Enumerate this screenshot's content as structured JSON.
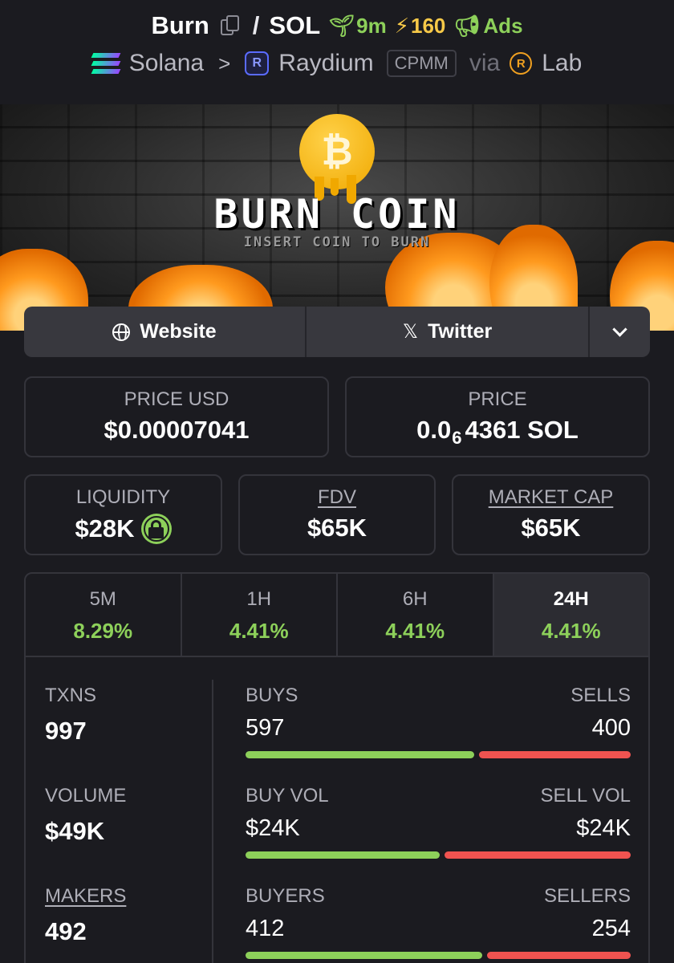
{
  "header": {
    "token_symbol": "Burn",
    "separator": "/",
    "quote_symbol": "SOL",
    "age": "9m",
    "boost": "160",
    "ads_label": "Ads",
    "chain": "Solana",
    "dex": "Raydium",
    "pool_type": "CPMM",
    "via_label": "via",
    "launchpad": "Lab"
  },
  "banner": {
    "title": "BURN COIN",
    "subtitle": "INSERT COIN TO BURN",
    "coin_symbol": "₿"
  },
  "links": {
    "website_label": "Website",
    "twitter_label": "Twitter"
  },
  "prices": {
    "price_usd_label": "PRICE USD",
    "price_usd": "$0.00007041",
    "price_label": "PRICE",
    "price_prefix": "0.0",
    "price_zeros": "6",
    "price_digits": "4361 SOL"
  },
  "metrics": {
    "liquidity_label": "LIQUIDITY",
    "liquidity": "$28K",
    "fdv_label": "FDV",
    "fdv": "$65K",
    "mcap_label": "MARKET CAP",
    "mcap": "$65K"
  },
  "timeframes": [
    {
      "label": "5M",
      "change": "8.29%"
    },
    {
      "label": "1H",
      "change": "4.41%"
    },
    {
      "label": "6H",
      "change": "4.41%"
    },
    {
      "label": "24H",
      "change": "4.41%"
    }
  ],
  "selected_timeframe": "24H",
  "txns": {
    "txns_label": "TXNS",
    "txns": "997",
    "buys_label": "BUYS",
    "buys": "597",
    "sells_label": "SELLS",
    "sells": "400",
    "buy_share": 0.6
  },
  "volume": {
    "volume_label": "VOLUME",
    "volume": "$49K",
    "buy_vol_label": "BUY VOL",
    "buy_vol": "$24K",
    "sell_vol_label": "SELL VOL",
    "sell_vol": "$24K",
    "buy_share": 0.51
  },
  "makers": {
    "makers_label": "MAKERS",
    "makers": "492",
    "buyers_label": "BUYERS",
    "buyers": "412",
    "sellers_label": "SELLERS",
    "sellers": "254",
    "buy_share": 0.62
  },
  "colors": {
    "positive": "#8dd05a",
    "negative": "#ef5350",
    "background": "#1b1b20",
    "boost": "#f7c948"
  }
}
